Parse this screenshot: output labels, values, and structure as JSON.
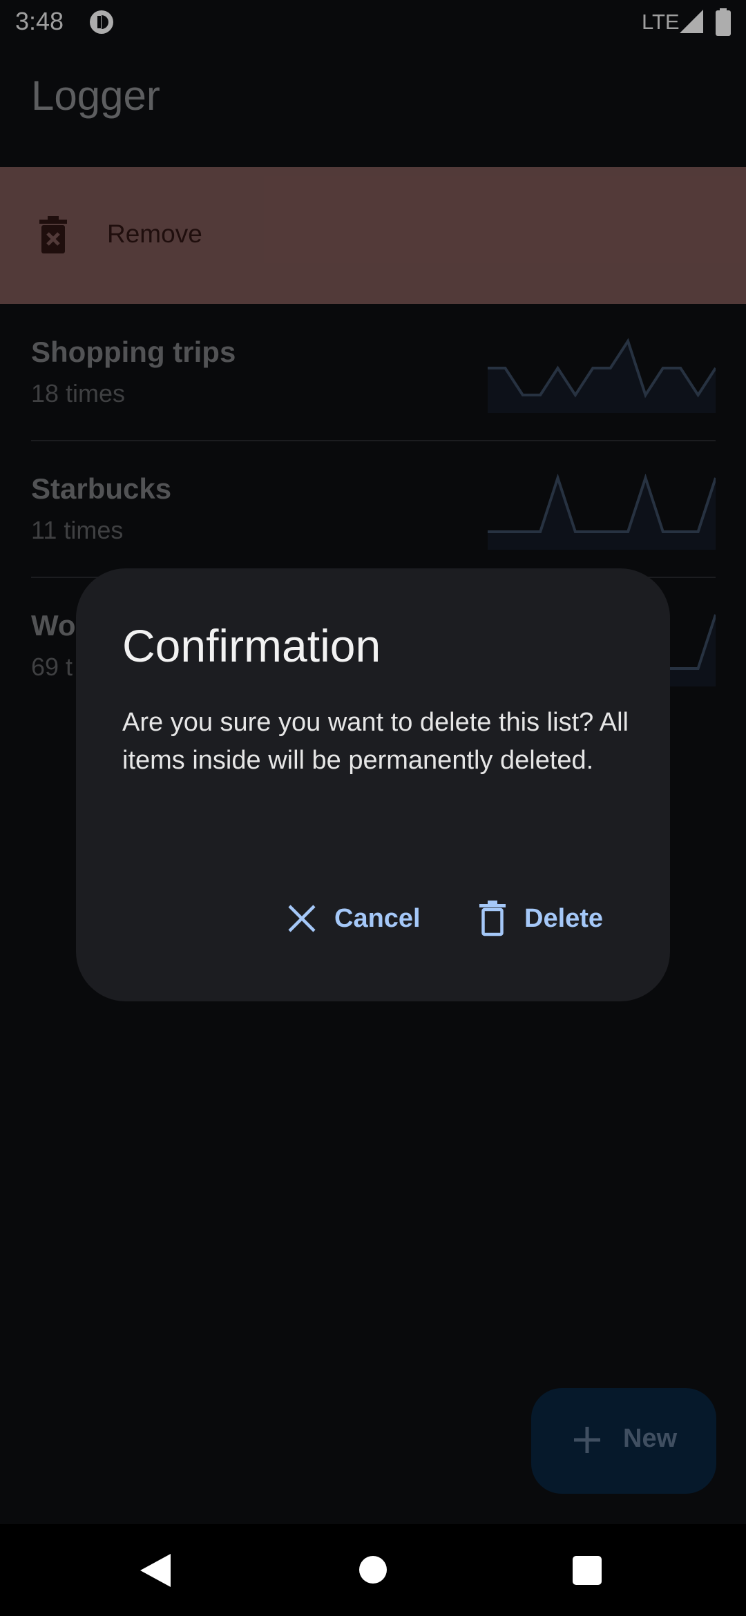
{
  "status_bar": {
    "time": "3:48",
    "network": "LTE"
  },
  "app_bar": {
    "title": "Logger"
  },
  "swipe_action": {
    "label": "Remove",
    "icon": "delete-icon"
  },
  "lists": [
    {
      "title": "Shopping trips",
      "count": "18 times",
      "sparkline": [
        1,
        1,
        0,
        0,
        1,
        0,
        1,
        1,
        2,
        0,
        1,
        1,
        0,
        1
      ]
    },
    {
      "title": "Starbucks",
      "count": "11 times",
      "sparkline": [
        0,
        0,
        0,
        0,
        1,
        0,
        0,
        0,
        0,
        1,
        0,
        0,
        0,
        1
      ]
    },
    {
      "title": "Wo",
      "count": "69 t",
      "sparkline": [
        0,
        0,
        0,
        0,
        0,
        0,
        0,
        0,
        0,
        0,
        0,
        0,
        0,
        1
      ]
    }
  ],
  "dialog": {
    "title": "Confirmation",
    "body": "Are you sure you want to delete this list? All items inside will be permanently deleted.",
    "cancel_label": "Cancel",
    "delete_label": "Delete"
  },
  "fab": {
    "label": "New"
  },
  "colors": {
    "background": "#0e0f12",
    "swipe_background": "#7a5654",
    "dialog_background": "#1c1d21",
    "accent": "#a5c8f8"
  }
}
